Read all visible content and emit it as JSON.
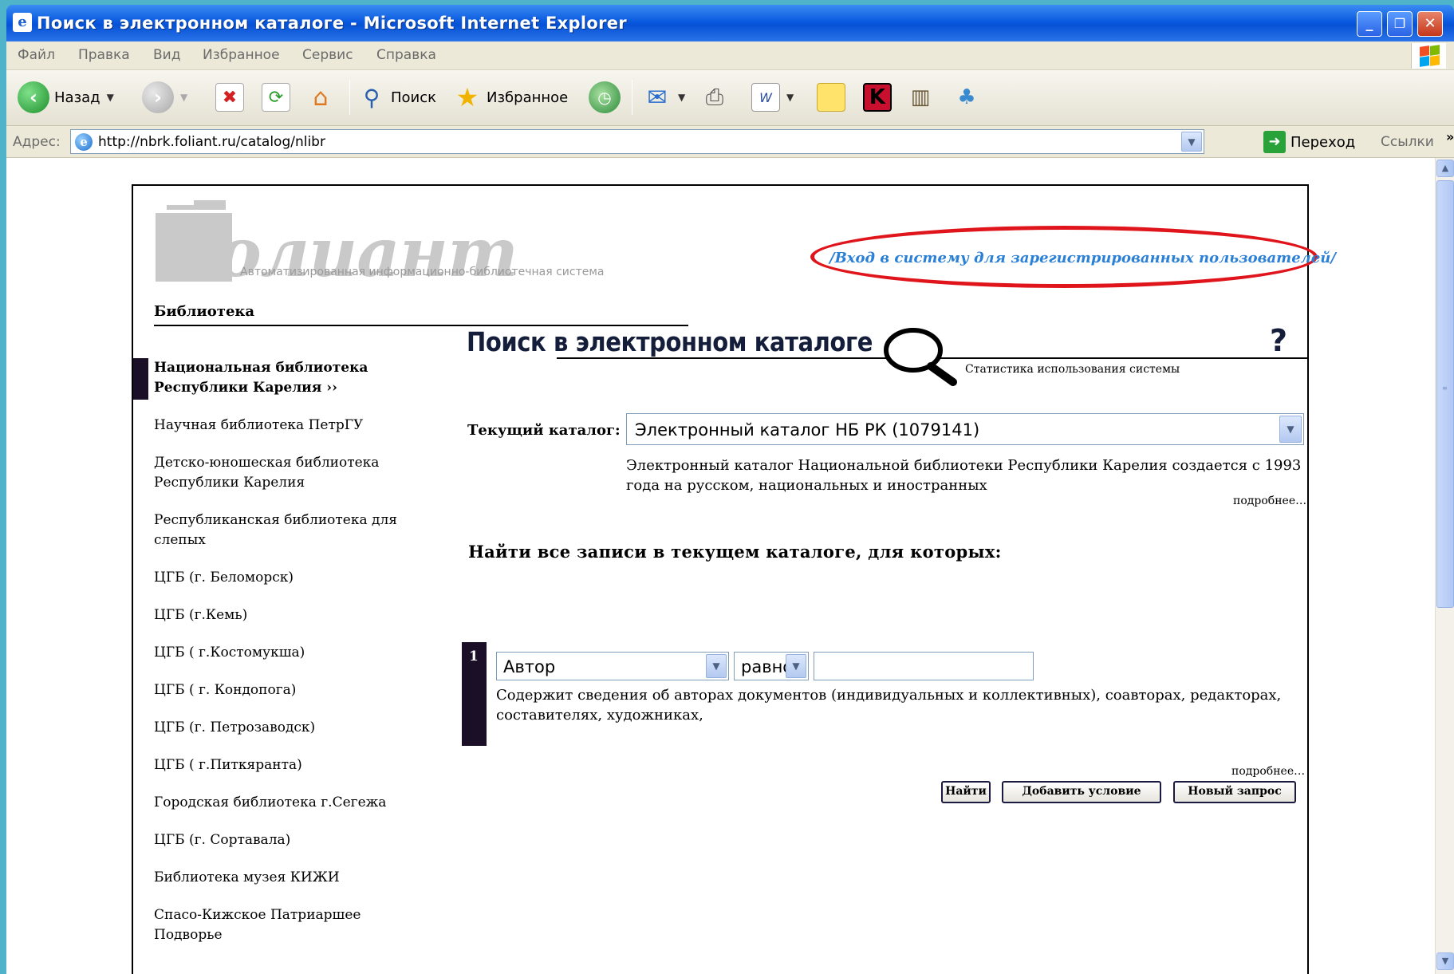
{
  "window": {
    "title": "Поиск в электронном каталоге - Microsoft Internet Explorer",
    "controls": {
      "minimize": "_",
      "maximize": "❐",
      "close": "✕"
    }
  },
  "menu": [
    "Файл",
    "Правка",
    "Вид",
    "Избранное",
    "Сервис",
    "Справка"
  ],
  "toolbar": {
    "back": "Назад",
    "search": "Поиск",
    "favorites": "Избранное"
  },
  "address": {
    "label": "Адрес:",
    "url": "http://nbrk.foliant.ru/catalog/nlibr",
    "go": "Переход",
    "links": "Ссылки",
    "more": "»"
  },
  "page": {
    "logo_text": "Фолиант",
    "logo_subtitle": "Автоматизированная информационно-библиотечная система",
    "login_link": "/Вход в систему для зарегистрированных пользователей/",
    "section_title": "Библиотека",
    "libraries": [
      "Национальная библиотека Республики Карелия ››",
      "Научная библиотека ПетрГУ",
      "Детско-юношеская библиотека Республики Карелия",
      "Республиканская библиотека для слепых",
      "ЦГБ (г. Беломорск)",
      "ЦГБ (г.Кемь)",
      "ЦГБ ( г.Костомукша)",
      "ЦГБ ( г. Кондопога)",
      "ЦГБ (г. Петрозаводск)",
      "ЦГБ ( г.Питкяранта)",
      "Городская библиотека г.Сегежа",
      "ЦГБ (г. Сортавала)",
      "Библиотека музея КИЖИ",
      "Спасо-Кижское Патриаршее Подворье"
    ],
    "main_title": "Поиск в электронном каталоге",
    "help": "?",
    "stats_link": "Статистика использования системы",
    "catalog_label": "Текущий каталог:",
    "catalog_value": "Электронный каталог НБ РК (1079141)",
    "catalog_desc": "Электронный каталог Национальной библиотеки Республики Карелия создается с 1993 года на русском, национальных и иностранных",
    "more": "подробнее…",
    "find_heading": "Найти все записи в текущем каталоге, для которых:",
    "condition": {
      "number": "1",
      "field": "Автор",
      "operator": "равно",
      "term": "",
      "desc": "Содержит сведения об авторах документов (индивидуальных и коллективных), соавторах, редакторах, составителях, художниках,"
    },
    "buttons": {
      "find": "Найти",
      "add_condition": "Добавить условие",
      "new_query": "Новый запрос"
    }
  },
  "colors": {
    "desktop": "#4fb3c9",
    "titlebar": "#0a5ae0",
    "login_link": "#2a7fd6",
    "highlight_ellipse": "#e0151c",
    "active_marker": "#1a0f26"
  }
}
